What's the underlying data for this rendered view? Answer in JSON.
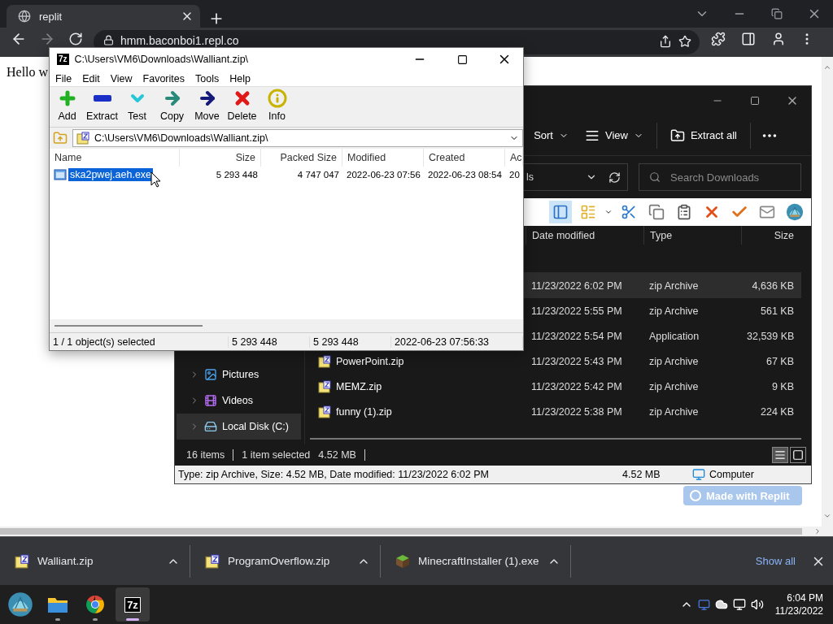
{
  "browser": {
    "tab": {
      "title": "replit"
    },
    "address": "hmm.baconboi1.repl.co"
  },
  "page": {
    "text": "Hello w",
    "badge": "Made with Replit"
  },
  "zip_window": {
    "logo": "7z",
    "title": "C:\\Users\\VM6\\Downloads\\Walliant.zip\\",
    "menu": [
      "File",
      "Edit",
      "View",
      "Favorites",
      "Tools",
      "Help"
    ],
    "toolbar": [
      {
        "label": "Add",
        "kind": "add"
      },
      {
        "label": "Extract",
        "kind": "extract"
      },
      {
        "label": "Test",
        "kind": "test"
      },
      {
        "label": "Copy",
        "kind": "copy"
      },
      {
        "label": "Move",
        "kind": "move"
      },
      {
        "label": "Delete",
        "kind": "delete"
      },
      {
        "label": "Info",
        "kind": "info"
      }
    ],
    "path": "C:\\Users\\VM6\\Downloads\\Walliant.zip\\",
    "columns": [
      "Name",
      "Size",
      "Packed Size",
      "Modified",
      "Created",
      "Ac"
    ],
    "rows": [
      {
        "cells": [
          "ska2pwej.aeh.exe",
          "5 293 448",
          "4 747 047",
          "2022-06-23 07:56",
          "2022-06-23 08:54",
          "20"
        ],
        "selected": true
      }
    ],
    "status": [
      "1 / 1 object(s) selected",
      "5 293 448",
      "5 293 448",
      "2022-06-23 07:56:33"
    ]
  },
  "explorer": {
    "commands": [
      {
        "label": "Sort",
        "kind": "sort"
      },
      {
        "label": "View",
        "kind": "view"
      },
      {
        "label": "Extract all",
        "kind": "extract"
      }
    ],
    "address_fragment": "ls",
    "search": {
      "placeholder": "Search Downloads"
    },
    "columns": [
      "Date modified",
      "Type",
      "Size"
    ],
    "nav": [
      {
        "label": "Pictures",
        "kind": "pictures",
        "selected": false
      },
      {
        "label": "Videos",
        "kind": "videos",
        "selected": false
      },
      {
        "label": "Local Disk (C:)",
        "kind": "disk",
        "selected": true
      }
    ],
    "files": [
      {
        "modified": "11/23/2022 6:02 PM",
        "type": "zip Archive",
        "size": "4,636 KB",
        "selected": true
      },
      {
        "modified": "11/23/2022 5:55 PM",
        "type": "zip Archive",
        "size": "561 KB",
        "selected": false
      },
      {
        "modified": "11/23/2022 5:54 PM",
        "type": "Application",
        "size": "32,539 KB",
        "selected": false
      },
      {
        "name": "PowerPoint.zip",
        "modified": "11/23/2022 5:43 PM",
        "type": "zip Archive",
        "size": "67 KB",
        "selected": false
      },
      {
        "name": "MEMZ.zip",
        "modified": "11/23/2022 5:42 PM",
        "type": "zip Archive",
        "size": "9 KB",
        "selected": false
      },
      {
        "name": "funny (1).zip",
        "modified": "11/23/2022 5:38 PM",
        "type": "zip Archive",
        "size": "224 KB",
        "selected": false
      }
    ],
    "status": {
      "count": "16 items",
      "selection": "1 item selected",
      "selection_size": "4.52 MB"
    },
    "classic_status": {
      "details": "Type: zip Archive, Size: 4.52 MB, Date modified: 11/23/2022 6:02 PM",
      "size": "4.52 MB",
      "location": "Computer"
    }
  },
  "downloads": {
    "items": [
      {
        "name": "Walliant.zip",
        "kind": "zip"
      },
      {
        "name": "ProgramOverflow.zip",
        "kind": "zip"
      },
      {
        "name": "MinecraftInstaller (1).exe",
        "kind": "installer"
      }
    ],
    "show_all": "Show all"
  },
  "taskbar": {
    "apps": [
      {
        "kind": "start",
        "running": false,
        "selected": false
      },
      {
        "kind": "explorer",
        "running": true,
        "selected": false
      },
      {
        "kind": "chrome",
        "running": true,
        "selected": false
      },
      {
        "kind": "sevenzip",
        "label": "7z",
        "running": true,
        "selected": true
      }
    ],
    "clock": {
      "time": "6:04 PM",
      "date": "11/23/2022"
    }
  }
}
